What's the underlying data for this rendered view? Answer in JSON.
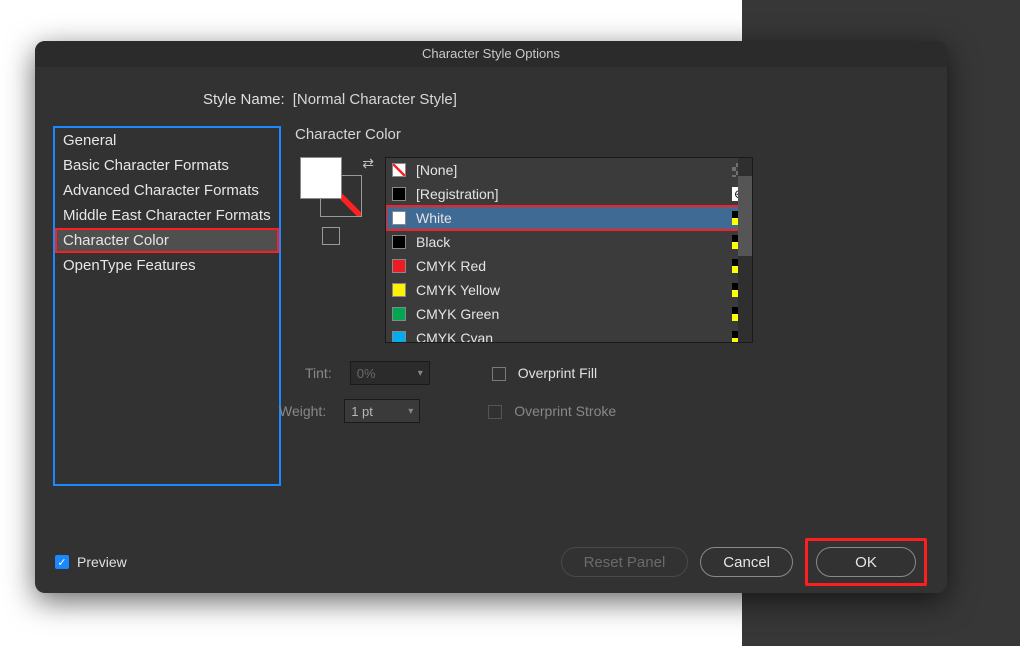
{
  "dialog": {
    "title": "Character Style Options",
    "styleNameLabel": "Style Name:",
    "styleNameValue": "[Normal Character Style]"
  },
  "categories": {
    "items": [
      {
        "label": "General"
      },
      {
        "label": "Basic Character Formats"
      },
      {
        "label": "Advanced Character Formats"
      },
      {
        "label": "Middle East Character Formats"
      },
      {
        "label": "Character Color"
      },
      {
        "label": "OpenType Features"
      }
    ],
    "selectedIndex": 4
  },
  "panel": {
    "title": "Character Color",
    "swatches": [
      {
        "name": "[None]",
        "chip": "none",
        "indicator": "none-edit"
      },
      {
        "name": "[Registration]",
        "chip": "#000000",
        "indicator": "reg"
      },
      {
        "name": "White",
        "chip": "#ffffff",
        "indicator": "cmyk"
      },
      {
        "name": "Black",
        "chip": "#000000",
        "indicator": "cmyk"
      },
      {
        "name": "CMYK Red",
        "chip": "#ed1c24",
        "indicator": "cmyk"
      },
      {
        "name": "CMYK Yellow",
        "chip": "#fff200",
        "indicator": "cmyk"
      },
      {
        "name": "CMYK Green",
        "chip": "#00a651",
        "indicator": "cmyk"
      },
      {
        "name": "CMYK Cyan",
        "chip": "#00aeef",
        "indicator": "cmyk"
      }
    ],
    "selectedSwatchIndex": 2,
    "tint": {
      "label": "Tint:",
      "value": "0%"
    },
    "overprintFill": {
      "label": "Overprint Fill",
      "checked": false
    },
    "weight": {
      "label": "Weight:",
      "value": "1 pt"
    },
    "overprintStroke": {
      "label": "Overprint Stroke",
      "checked": false
    }
  },
  "footer": {
    "previewLabel": "Preview",
    "previewChecked": true,
    "resetLabel": "Reset Panel",
    "cancelLabel": "Cancel",
    "okLabel": "OK"
  }
}
